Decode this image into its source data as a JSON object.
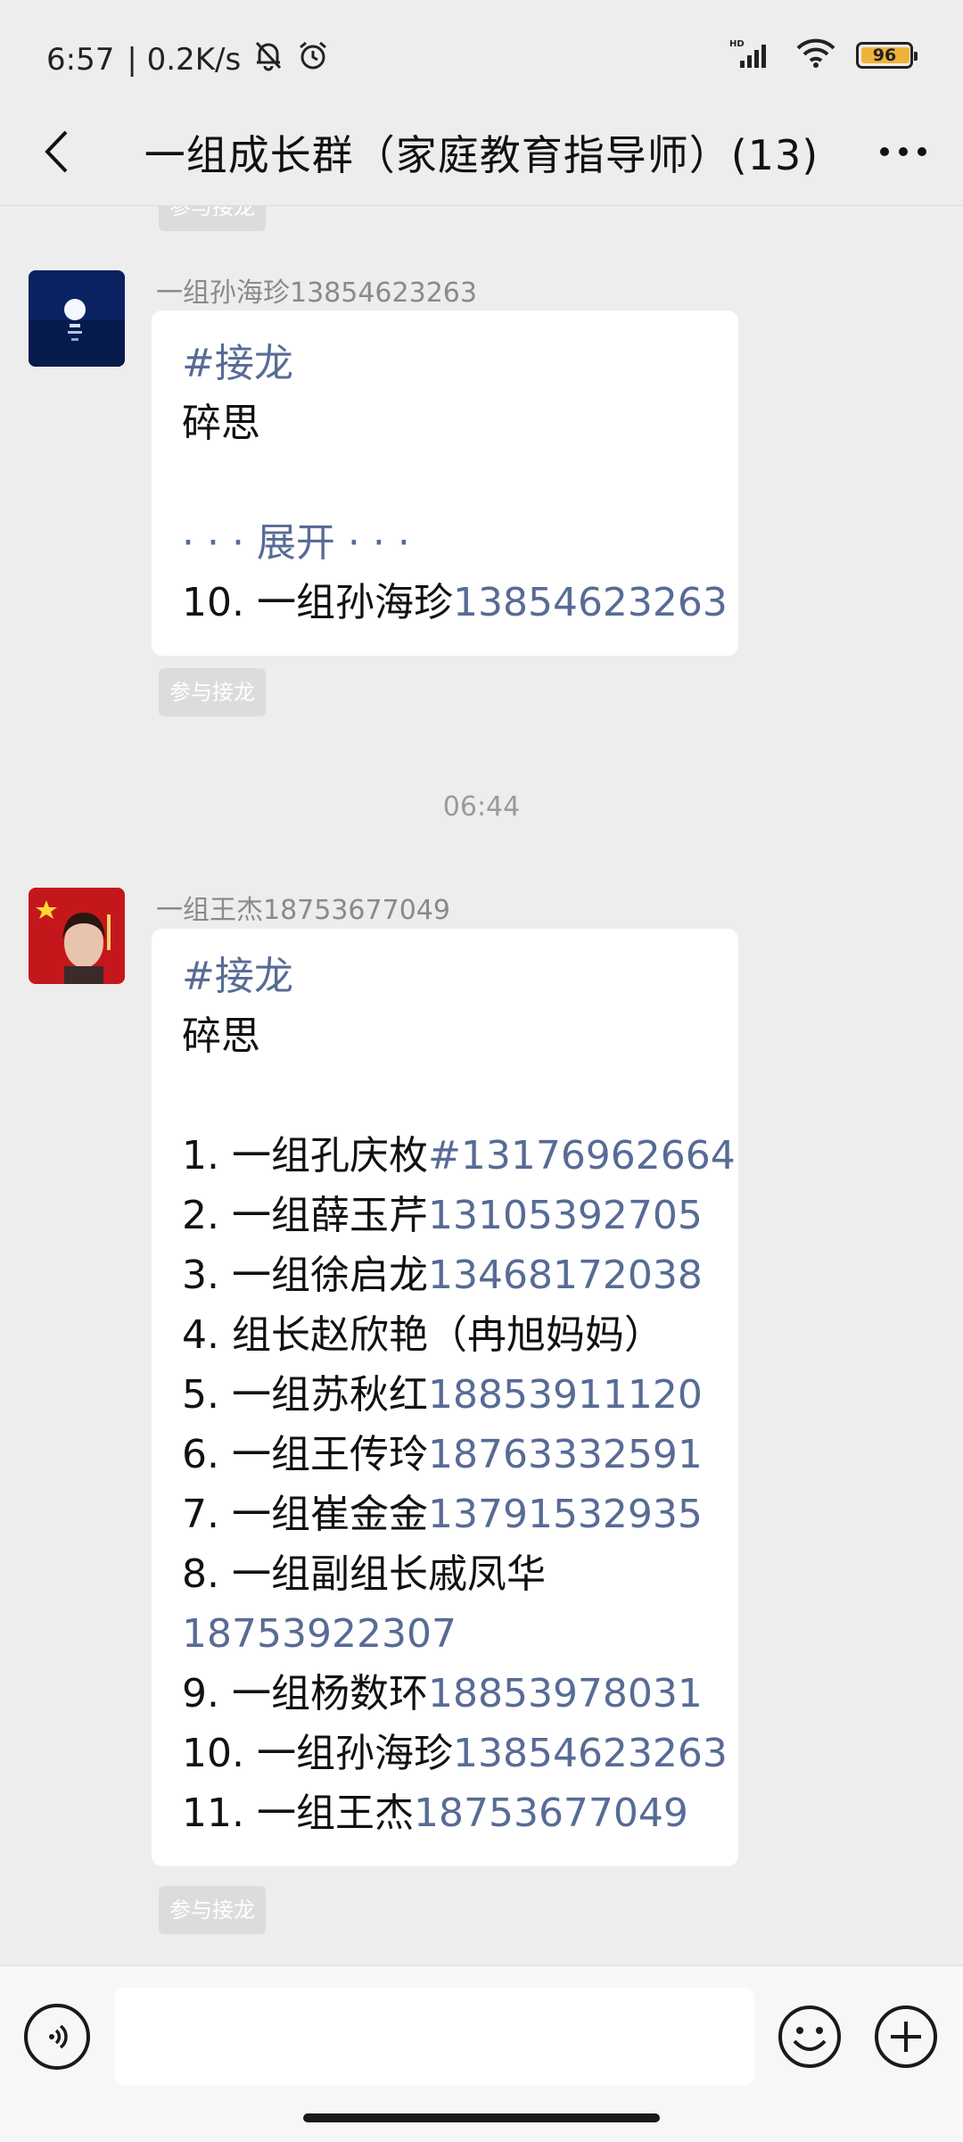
{
  "status": {
    "time": "6:57",
    "speed": "| 0.2K/s",
    "battery": "96"
  },
  "nav": {
    "title": "一组成长群（家庭教育指导师）(13)"
  },
  "messages": [
    {
      "join_label_top": "参与接龙"
    },
    {
      "sender": "一组孙海珍13854623263",
      "tag": "#接龙",
      "subject": "碎思",
      "expand": "· · · 展开 · · ·",
      "entry_text": "10. 一组孙海珍",
      "entry_phone": "13854623263",
      "join_label": "参与接龙"
    },
    {
      "time": "06:44"
    },
    {
      "sender": "一组王杰18753677049",
      "tag": "#接龙",
      "subject": "碎思",
      "entries": [
        {
          "text": "1. 一组孔庆枚",
          "phone": "#13176962664"
        },
        {
          "text": "2. 一组薛玉芹",
          "phone": "13105392705"
        },
        {
          "text": "3. 一组徐启龙",
          "phone": "13468172038"
        },
        {
          "text": "4. 组长赵欣艳（冉旭妈妈）",
          "phone": ""
        },
        {
          "text": "5. 一组苏秋红",
          "phone": "18853911120"
        },
        {
          "text": "6. 一组王传玲",
          "phone": "18763332591"
        },
        {
          "text": "7. 一组崔金金",
          "phone": "13791532935"
        },
        {
          "text": "8. 一组副组长戚凤华",
          "phone": ""
        },
        {
          "text": "",
          "phone": "18753922307"
        },
        {
          "text": "9. 一组杨数环",
          "phone": "18853978031"
        },
        {
          "text": "10. 一组孙海珍",
          "phone": "13854623263"
        },
        {
          "text": "11. 一组王杰",
          "phone": "18753677049"
        }
      ],
      "join_label": "参与接龙"
    }
  ],
  "input": {
    "placeholder": ""
  }
}
